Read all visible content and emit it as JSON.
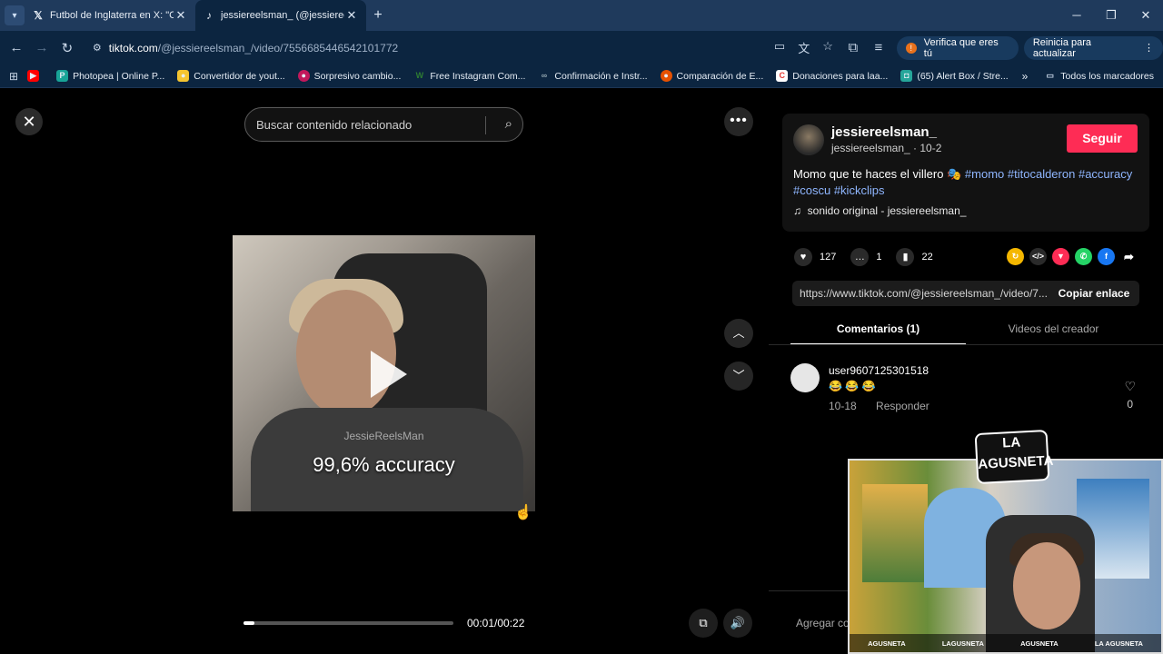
{
  "tabs": [
    {
      "icon": "x-logo-icon",
      "title": "Futbol de Inglaterra en X: \"Che",
      "active": false
    },
    {
      "icon": "tiktok-icon",
      "title": "jessiereelsman_ (@jessiereelsm",
      "active": true
    }
  ],
  "address": {
    "domain": "tiktok.com",
    "path": "/@jessiereelsman_/video/7556685446542101772"
  },
  "toolbar": {
    "verify_label": "Verifica que eres tú",
    "update_label": "Reinicia para actualizar"
  },
  "bookmarks": [
    {
      "label": "",
      "icon": "youtube-icon",
      "color": "#ff0000"
    },
    {
      "label": "Photopea | Online P...",
      "icon": "photopea-icon",
      "color": "#18a497"
    },
    {
      "label": "Convertidor de yout...",
      "icon": "converter-icon",
      "color": "#f4c430"
    },
    {
      "label": "Sorpresivo cambio...",
      "icon": "news-icon",
      "color": "#c2185b"
    },
    {
      "label": "Free Instagram Com...",
      "icon": "w-icon",
      "color": "#2e7d32"
    },
    {
      "label": "Confirmación e Instr...",
      "icon": "link-icon",
      "color": "#90a4ae"
    },
    {
      "label": "Comparación de E...",
      "icon": "compare-icon",
      "color": "#e65100"
    },
    {
      "label": "Donaciones para laa...",
      "icon": "donation-icon",
      "color": "#e53935"
    },
    {
      "label": "(65) Alert Box / Stre...",
      "icon": "alertbox-icon",
      "color": "#26a69a"
    }
  ],
  "bookmarks_all": "Todos los marcadores",
  "search": {
    "placeholder": "Buscar contenido relacionado"
  },
  "video": {
    "watermark": "JessieReelsMan",
    "caption": "99,6% accuracy",
    "time": "00:01/00:22",
    "progress": 0.05
  },
  "post": {
    "username": "jessiereelsman_",
    "handle_date": "jessiereelsman_ · 10-2",
    "follow_label": "Seguir",
    "description": "Momo que te haces el villero 🎭",
    "tags": [
      "#momo",
      "#titocalderon",
      "#accuracy",
      "#coscu",
      "#kickclips"
    ],
    "sound": "sonido original - jessiereelsman_",
    "likes": "127",
    "comments": "1",
    "saves": "22",
    "link": "https://www.tiktok.com/@jessiereelsman_/video/7...",
    "copy_label": "Copiar enlace"
  },
  "panel_tabs": [
    "Comentarios (1)",
    "Videos del creador"
  ],
  "comment": {
    "user": "user9607125301518",
    "text": "😂 😂 😂",
    "date": "10-18",
    "reply": "Responder",
    "likes": "0"
  },
  "add_comment_placeholder": "Agregar co",
  "overlay": {
    "logo": "LA AGUSNETA",
    "socials": [
      "AGUSNETA",
      "LAGUSNETA",
      "AGUSNETA",
      "LA AGUSNETA"
    ]
  },
  "colors": {
    "follow": "#fe2c55",
    "tag": "#8fb6ff",
    "chrome": "#0c2540"
  }
}
